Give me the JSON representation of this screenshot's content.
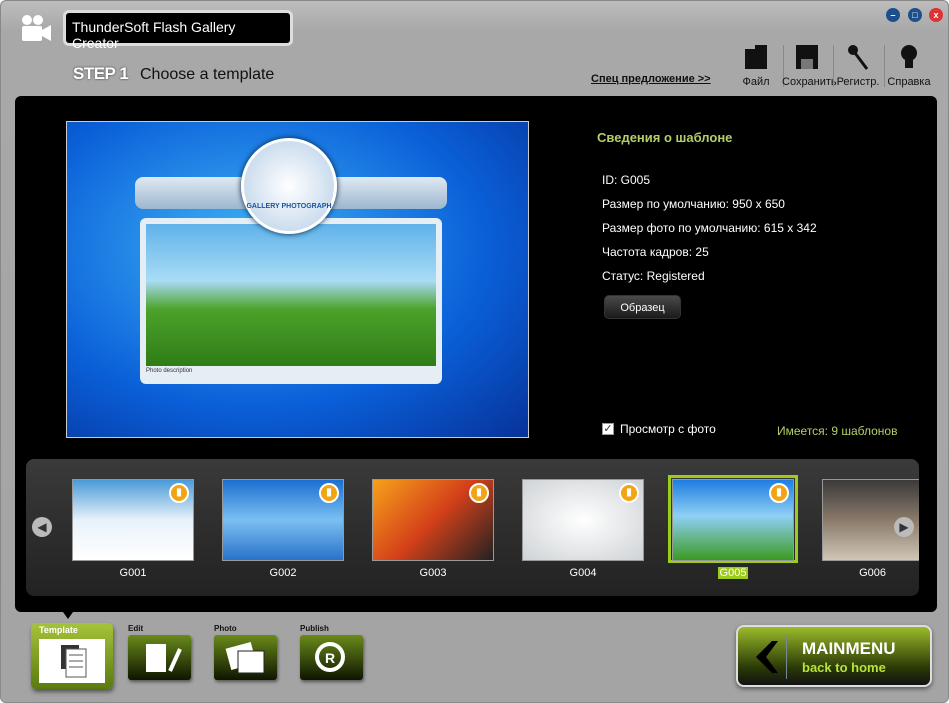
{
  "window": {
    "title": "ThunderSoft Flash Gallery Creator",
    "controls": [
      "minimize",
      "maximize",
      "close"
    ]
  },
  "header": {
    "step": "STEP 1",
    "step_title": "Choose a template",
    "special_offer": "Спец предложение >>",
    "toolbar": [
      {
        "label": "Файл",
        "icon": "folder-icon"
      },
      {
        "label": "Сохранить",
        "icon": "save-icon"
      },
      {
        "label": "Регистр.",
        "icon": "key-icon"
      },
      {
        "label": "Справка",
        "icon": "lightbulb-icon"
      }
    ]
  },
  "preview": {
    "logo_text": "GALLERY PHOTOGRAPH",
    "caption": "Photo description"
  },
  "info": {
    "title": "Сведения о шаблоне",
    "id": "ID: G005",
    "default_size": "Размер по умолчанию: 950 x 650",
    "photo_size": "Размер фото по умолчанию: 615 x 342",
    "frame_rate": "Частота кадров: 25",
    "status": "Статус: Registered",
    "sample_button": "Образец",
    "preview_with_photo": "Просмотр с фото",
    "preview_checked": true,
    "available": "Имеется: 9 шаблонов"
  },
  "templates": [
    {
      "label": "G001"
    },
    {
      "label": "G002"
    },
    {
      "label": "G003"
    },
    {
      "label": "G004"
    },
    {
      "label": "G005",
      "selected": true
    },
    {
      "label": "G006"
    }
  ],
  "footer": {
    "tabs": [
      {
        "label": "Template",
        "active": true
      },
      {
        "label": "Edit"
      },
      {
        "label": "Photo"
      },
      {
        "label": "Publish"
      }
    ],
    "mainmenu": "MAINMENU",
    "back": "back to home"
  },
  "colors": {
    "accent": "#9ccc1c",
    "info_green": "#b3cf6a"
  }
}
